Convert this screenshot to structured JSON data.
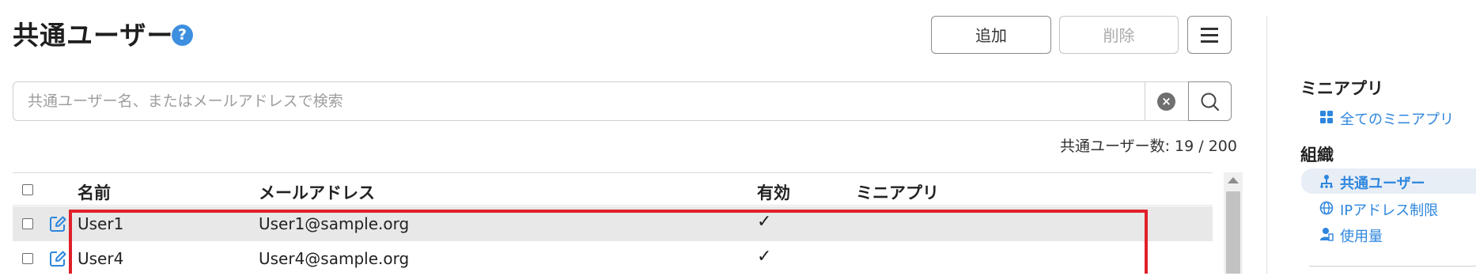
{
  "header": {
    "title": "共通ユーザー",
    "help_icon": "?",
    "add_label": "追加",
    "delete_label": "削除",
    "menu_icon": "hamburger-menu-icon"
  },
  "search": {
    "placeholder": "共通ユーザー名、またはメールアドレスで検索",
    "clear_icon": "×",
    "search_icon": "search-icon"
  },
  "count_text": "共通ユーザー数: 19 / 200",
  "table": {
    "columns": [
      "名前",
      "メールアドレス",
      "有効",
      "ミニアプリ"
    ],
    "rows": [
      {
        "name": "User1",
        "email": "User1@sample.org",
        "enabled": "✓",
        "mini_apps": ""
      },
      {
        "name": "User4",
        "email": "User4@sample.org",
        "enabled": "✓",
        "mini_apps": ""
      }
    ]
  },
  "sidebar": {
    "mini_apps_heading": "ミニアプリ",
    "mini_apps_items": [
      {
        "label": "全てのミニアプリ",
        "icon": "grid-icon"
      }
    ],
    "org_heading": "組織",
    "org_items": [
      {
        "label": "共通ユーザー",
        "icon": "users-icon",
        "active": true
      },
      {
        "label": "IPアドレス制限",
        "icon": "globe-icon"
      },
      {
        "label": "使用量",
        "icon": "usage-icon"
      }
    ]
  },
  "colors": {
    "accent": "#2e86de",
    "highlight": "#e0202a",
    "selected_row": "#e8e8e8"
  }
}
